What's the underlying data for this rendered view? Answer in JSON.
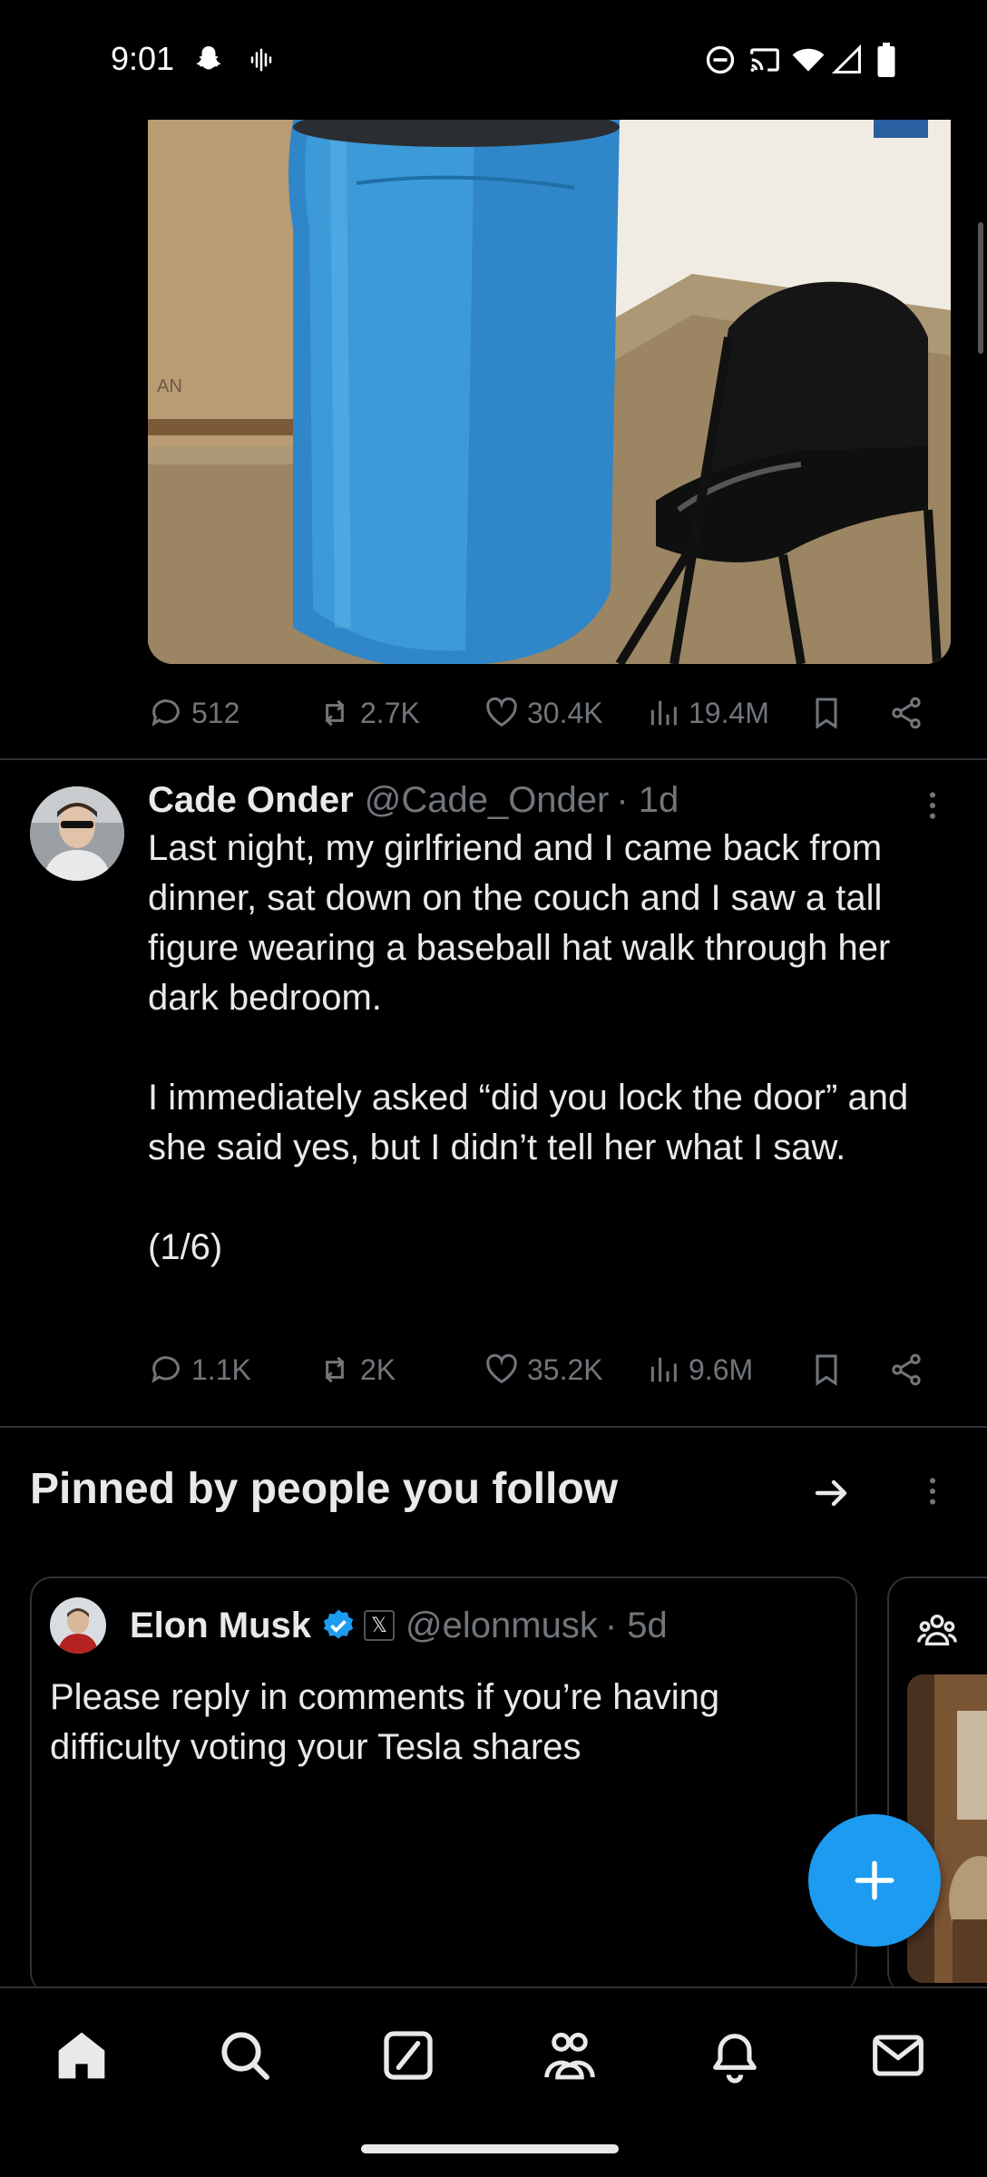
{
  "status_bar": {
    "time": "9:01",
    "icons": [
      "snapchat-icon",
      "voice-icon",
      "do-not-disturb-icon",
      "cast-icon",
      "wifi-icon",
      "signal-icon",
      "battery-icon"
    ]
  },
  "top_post": {
    "media_description_icon": "blue-barrel-chair-photo",
    "actions": {
      "replies": "512",
      "reposts": "2.7K",
      "likes": "30.4K",
      "views": "19.4M"
    }
  },
  "tweet": {
    "author_name": "Cade Onder",
    "handle": "@Cade_Onder",
    "time": "· 1d",
    "paragraph1": "Last night, my girlfriend and I came back from dinner, sat down on the couch and I saw a tall figure wearing a baseball hat walk through her dark bedroom.",
    "paragraph2": "I immediately asked “did you lock the door” and she said yes, but I didn’t tell her what I saw.",
    "paragraph3": "(1/6)",
    "actions": {
      "replies": "1.1K",
      "reposts": "2K",
      "likes": "35.2K",
      "views": "9.6M"
    }
  },
  "pinned": {
    "title": "Pinned by people you follow",
    "card": {
      "author_name": "Elon Musk",
      "badge": "𝕏",
      "handle": "@elonmusk",
      "time": "· 5d",
      "text": "Please reply in comments if you’re having difficulty voting your Tesla shares"
    }
  },
  "colors": {
    "background": "#000000",
    "text": "#e7e9ea",
    "muted": "#71767b",
    "accent": "#1d9bf0",
    "divider": "#2f3336"
  },
  "bottom_nav": [
    "home-icon",
    "search-icon",
    "grok-icon",
    "communities-icon",
    "notifications-icon",
    "messages-icon"
  ]
}
